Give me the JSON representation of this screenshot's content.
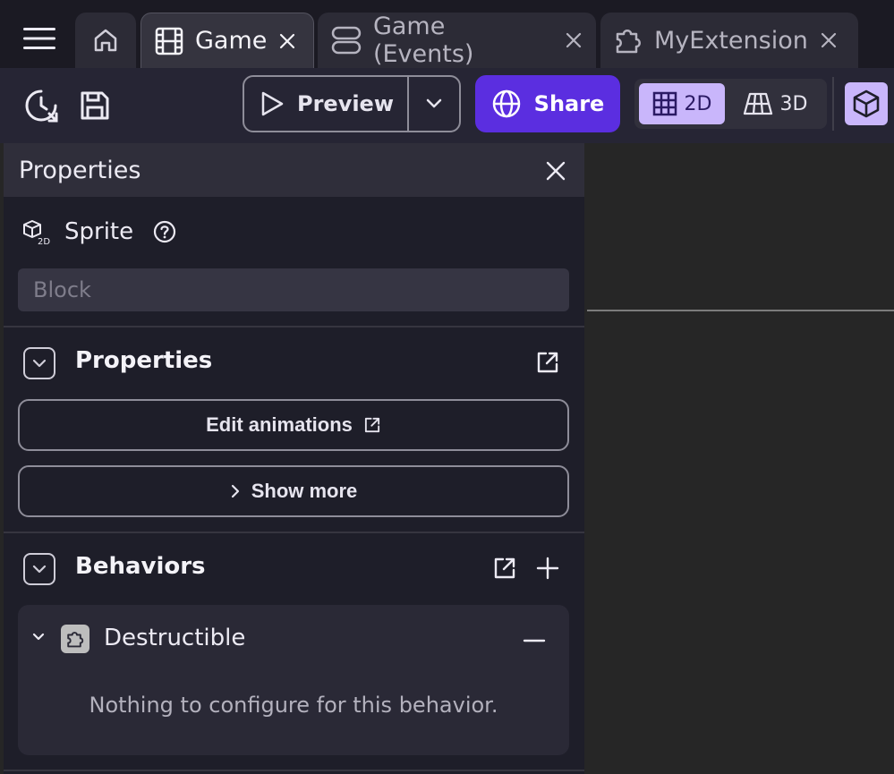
{
  "tabs": {
    "home_icon": "home-icon",
    "items": [
      {
        "label": "Game",
        "icon": "film-icon",
        "active": true
      },
      {
        "label": "Game (Events)",
        "icon": "events-icon",
        "active": false
      },
      {
        "label": "MyExtension",
        "icon": "puzzle-icon",
        "active": false
      }
    ]
  },
  "toolbar": {
    "preview_label": "Preview",
    "share_label": "Share",
    "mode_2d_label": "2D",
    "mode_3d_label": "3D",
    "active_mode": "2D"
  },
  "properties_panel": {
    "title": "Properties",
    "object_type": "Sprite",
    "name_placeholder": "Block",
    "properties_section": {
      "title": "Properties",
      "edit_animations_label": "Edit animations",
      "show_more_label": "Show more"
    },
    "behaviors_section": {
      "title": "Behaviors",
      "items": [
        {
          "name": "Destructible",
          "empty_message": "Nothing to configure for this behavior."
        }
      ]
    }
  },
  "colors": {
    "accent": "#5b2ee0",
    "mode_active": "#c9b6fb",
    "panel_bg": "#1e1e29",
    "canvas_bg": "#262626"
  }
}
